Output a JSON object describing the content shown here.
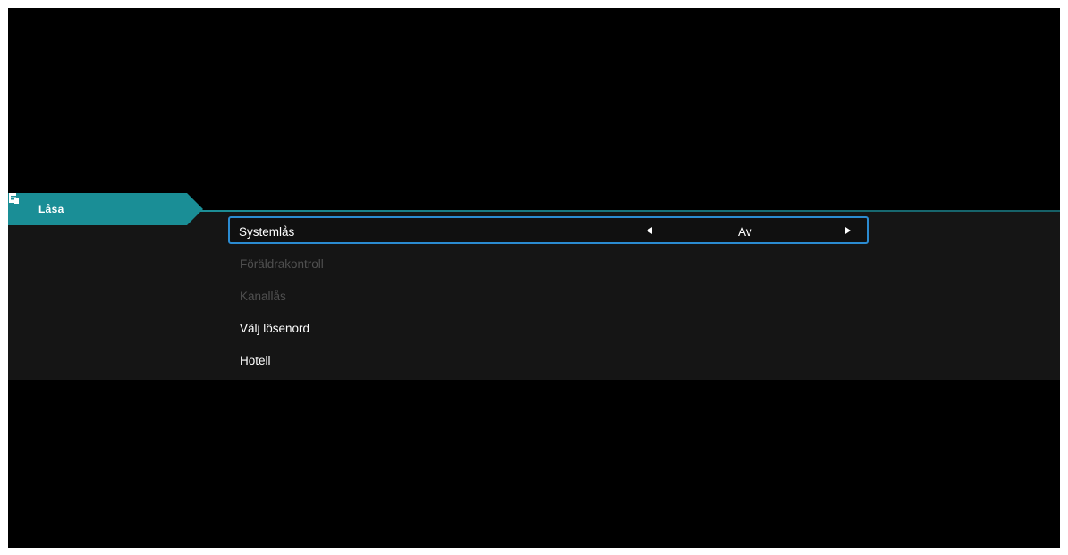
{
  "tab": {
    "label": "Låsa",
    "icon": "lock-document-icon",
    "color": "#1a8e96"
  },
  "menu": {
    "items": [
      {
        "label": "Systemlås",
        "value": "Av",
        "state": "selected"
      },
      {
        "label": "Föräldrakontroll",
        "state": "disabled"
      },
      {
        "label": "Kanallås",
        "state": "disabled"
      },
      {
        "label": "Välj lösenord",
        "state": "enabled"
      },
      {
        "label": "Hotell",
        "state": "enabled"
      }
    ]
  },
  "colors": {
    "accent": "#1a8e96",
    "focus_border": "#2b8bd1",
    "panel_bg": "#151515",
    "screen_bg": "#000000",
    "disabled_text": "#505050"
  }
}
